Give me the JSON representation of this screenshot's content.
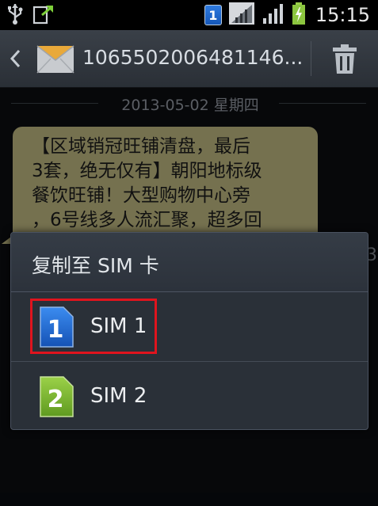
{
  "statusbar": {
    "sim_indicator": "1",
    "time": "15:15",
    "icons": [
      "usb-icon",
      "download-icon",
      "sim1-badge-icon",
      "signal-icon",
      "signal-icon",
      "battery-charging-icon"
    ]
  },
  "actionbar": {
    "contact": "1065502006481146...",
    "icons": [
      "back-icon",
      "envelope-icon",
      "trash-icon"
    ]
  },
  "conversation": {
    "date": "2013-05-02 星期四",
    "message_lines": [
      "【区域销冠旺铺清盘，最后",
      "3套，绝无仅有】朝阳地标级",
      "餐饮旺铺！大型购物中心旁",
      "，6号线多人流汇聚，超多回"
    ],
    "peek_text": "3"
  },
  "dialog": {
    "title": "复制至 SIM 卡",
    "options": [
      {
        "label": "SIM 1",
        "badge": "1",
        "badge_color": "#1f6ed6"
      },
      {
        "label": "SIM 2",
        "badge": "2",
        "badge_color": "#7cb82f"
      }
    ],
    "highlight_color": "#e0141e"
  }
}
